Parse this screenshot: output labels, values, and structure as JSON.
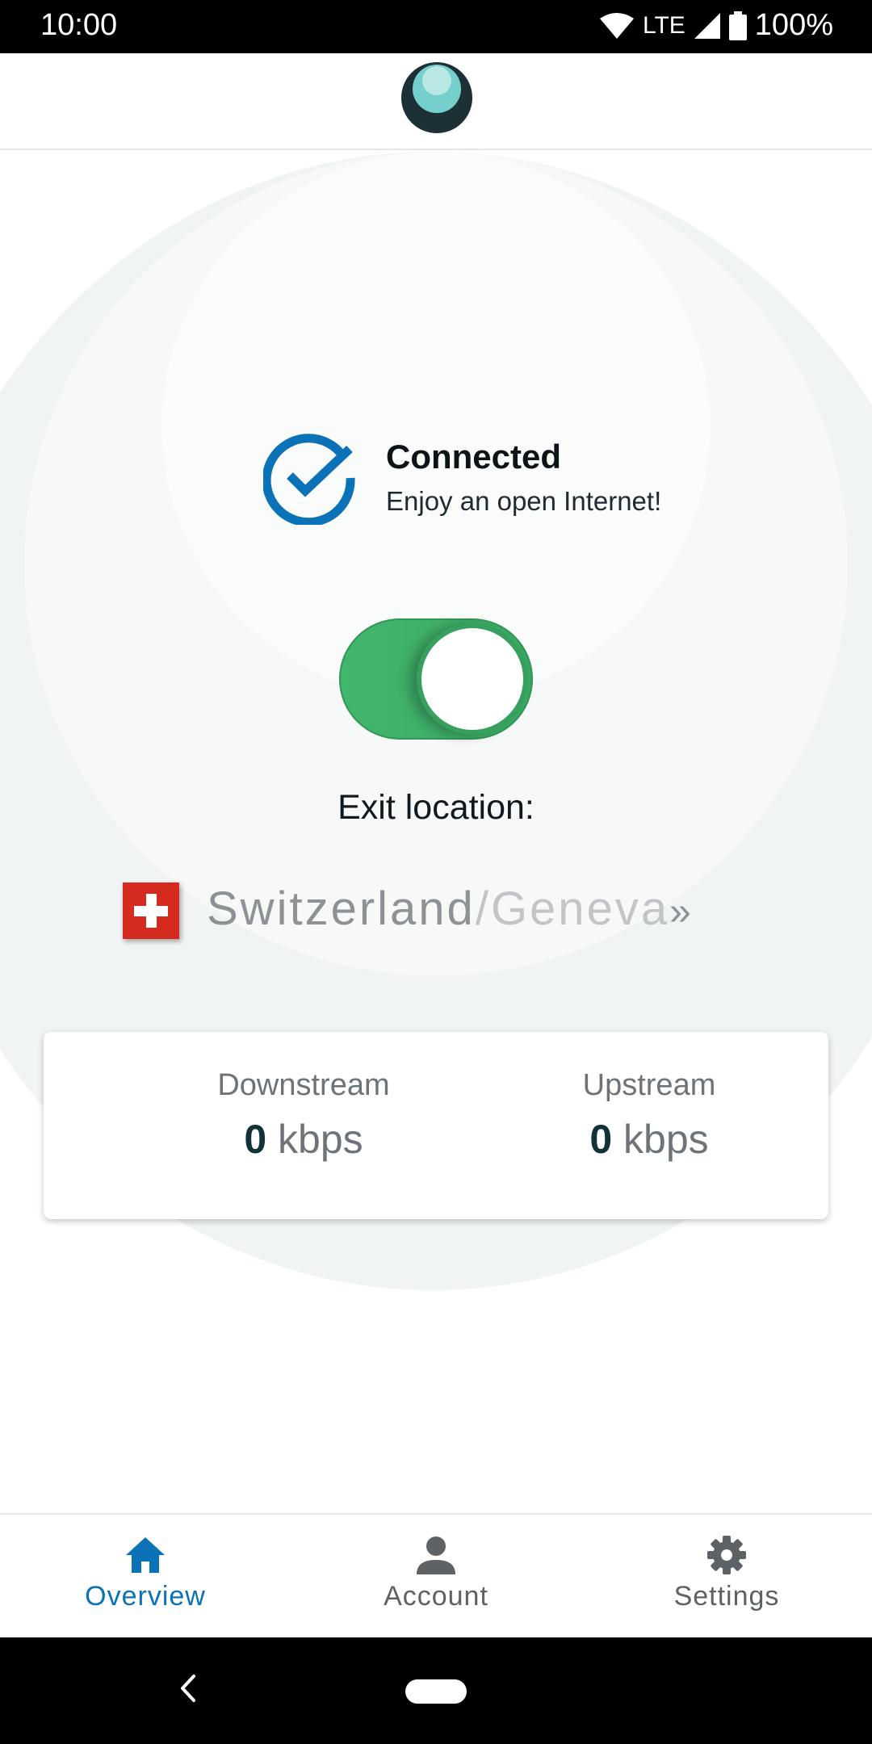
{
  "status_bar": {
    "time": "10:00",
    "network": "LTE",
    "battery": "100%"
  },
  "app_bar": {
    "logo_icon": "app-logo-icon"
  },
  "connection": {
    "title": "Connected",
    "subtitle": "Enjoy an open Internet!",
    "toggle_on": true,
    "accent_color": "#0b72b8",
    "toggle_color": "#43b66e"
  },
  "exit": {
    "label": "Exit location:",
    "country": "Switzerland",
    "separator": "/",
    "city": "Geneva",
    "arrow": "»",
    "flag_icon": "swiss-flag-icon"
  },
  "stats": {
    "downstream_label": "Downstream",
    "downstream_value": "0",
    "downstream_unit": "kbps",
    "upstream_label": "Upstream",
    "upstream_value": "0",
    "upstream_unit": "kbps"
  },
  "nav": {
    "overview": "Overview",
    "account": "Account",
    "settings": "Settings",
    "active": "Overview"
  }
}
